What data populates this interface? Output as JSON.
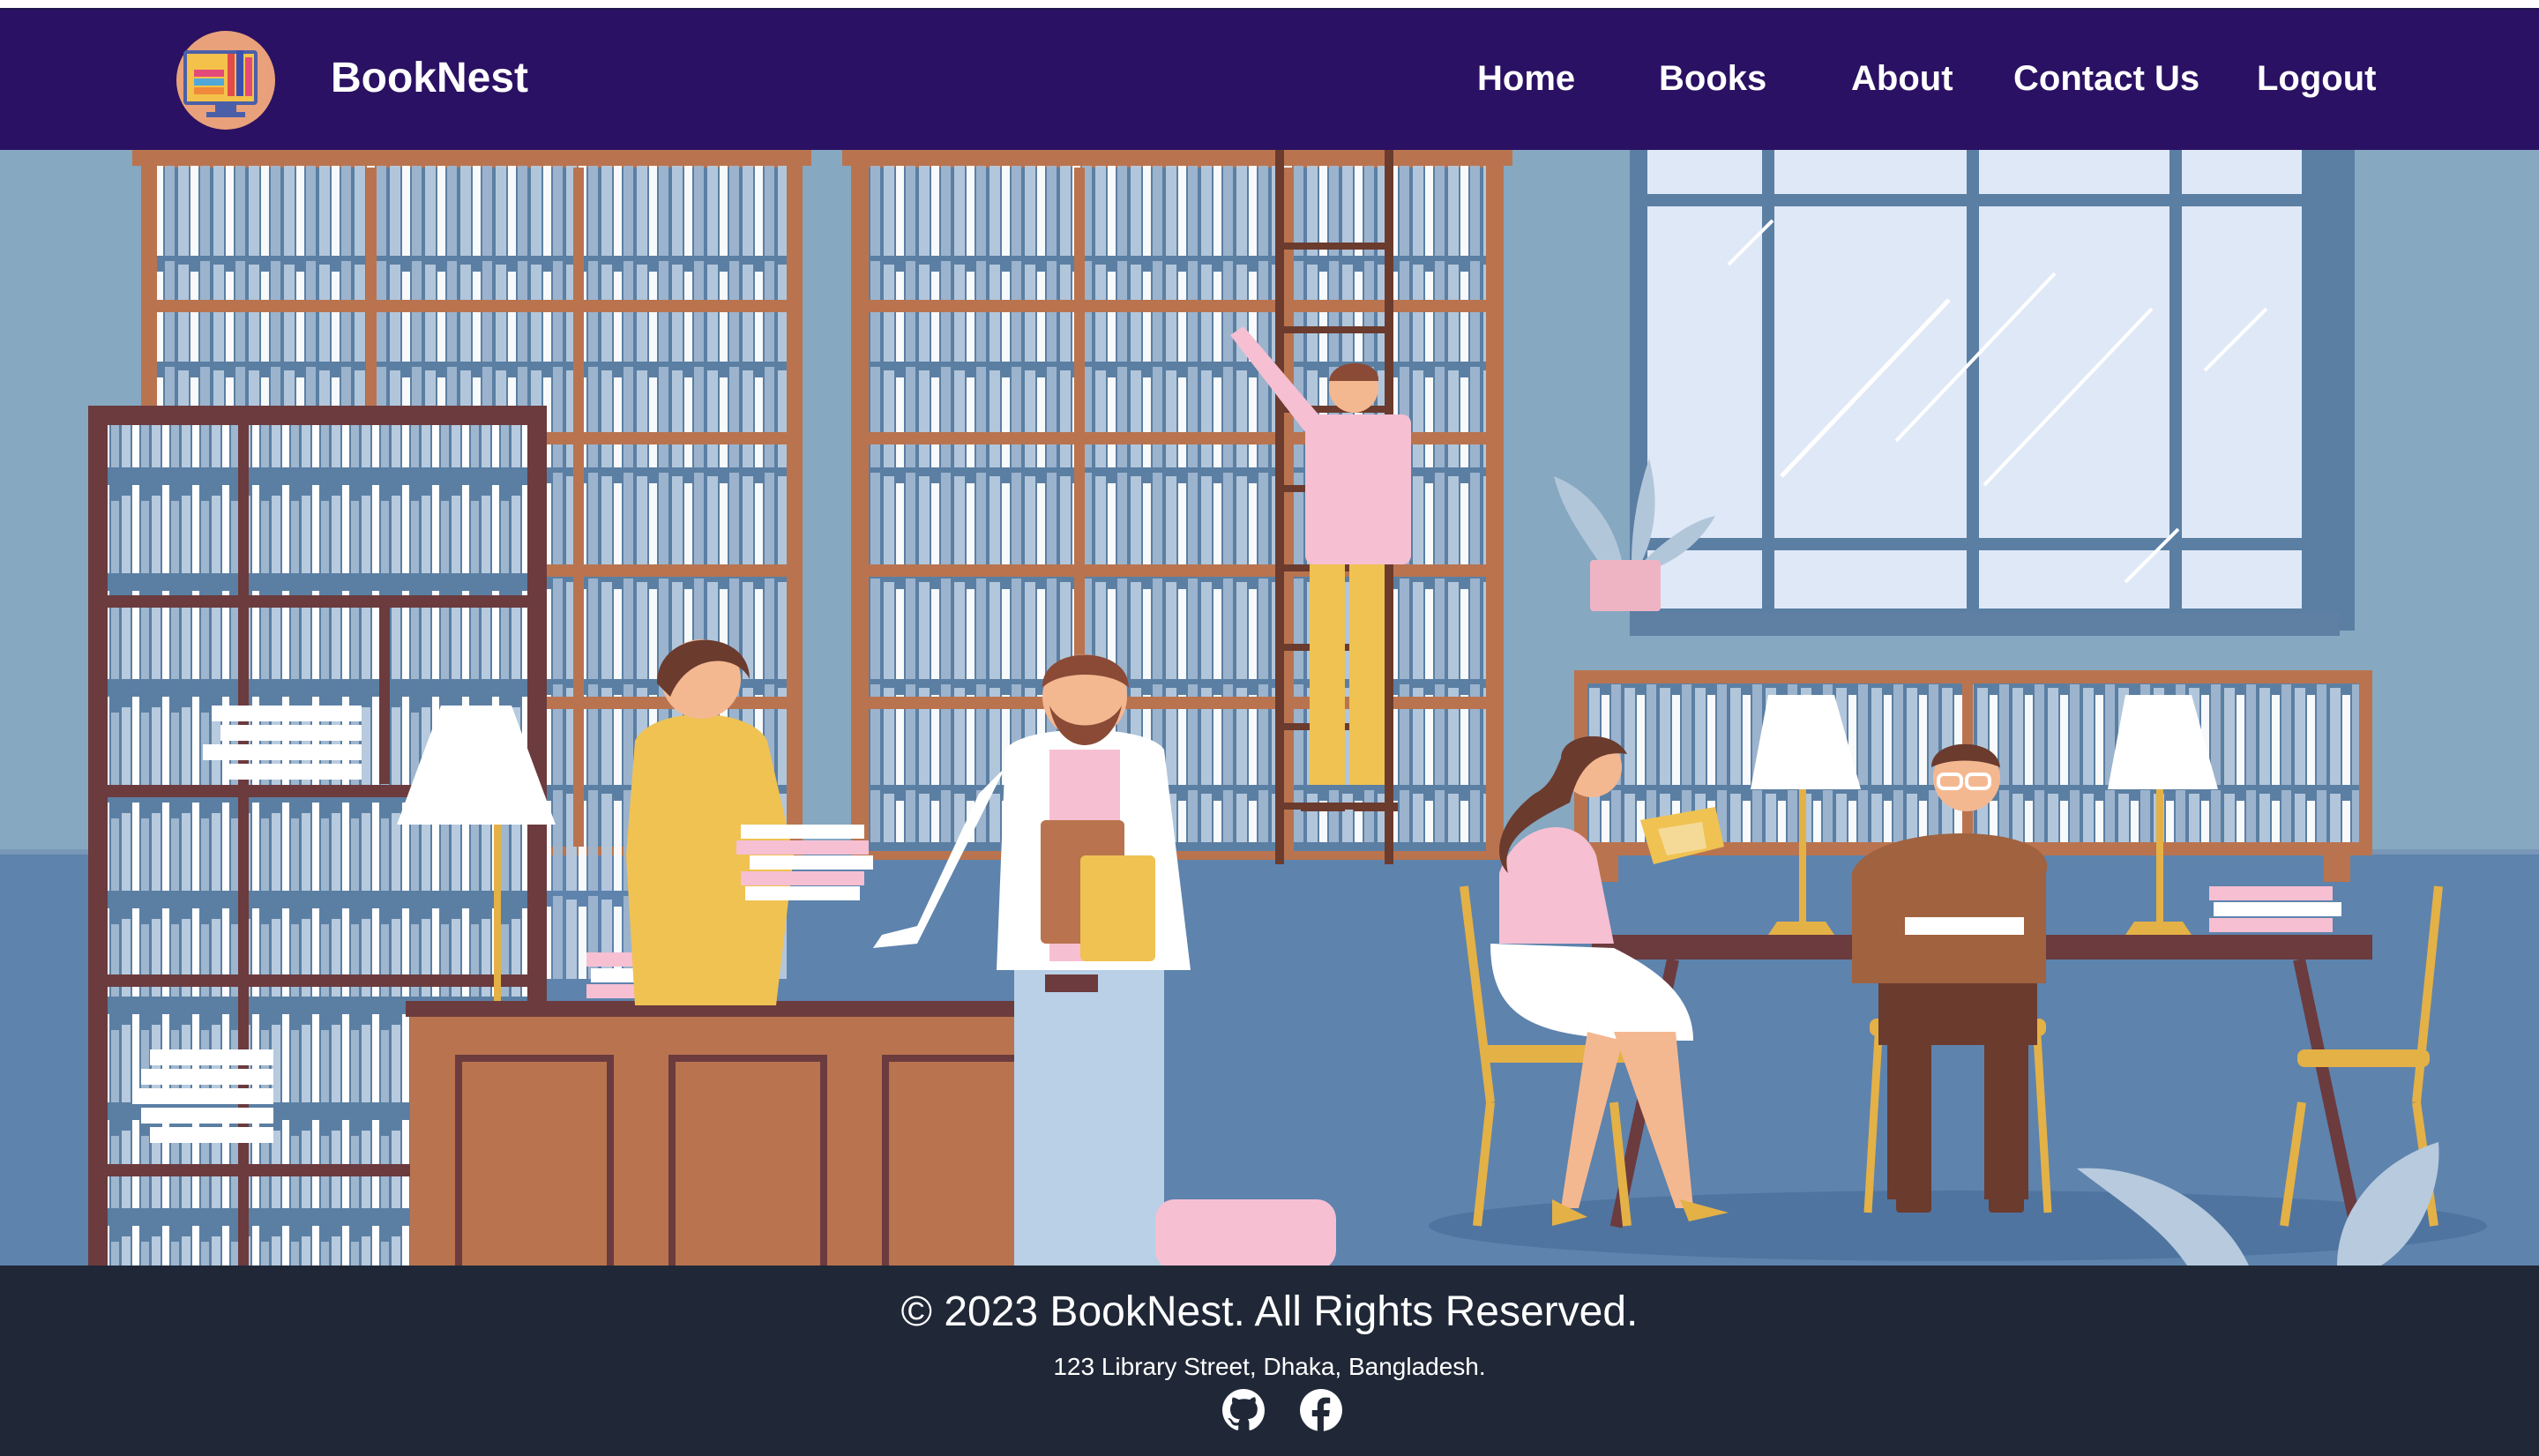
{
  "brand": {
    "name": "BookNest"
  },
  "nav": {
    "home": "Home",
    "books": "Books",
    "about": "About",
    "contact": "Contact Us",
    "logout": "Logout"
  },
  "footer": {
    "copyright": "© 2023 BookNest. All Rights Reserved.",
    "address": "123 Library Street, Dhaka, Bangladesh."
  },
  "icons": {
    "logo": "booknest-logo",
    "github": "github-icon",
    "facebook": "facebook-icon"
  },
  "colors": {
    "navbar": "#2a1163",
    "footer": "#202837",
    "hero_wall": "#86a8c1",
    "hero_floor": "#5e83ad"
  }
}
